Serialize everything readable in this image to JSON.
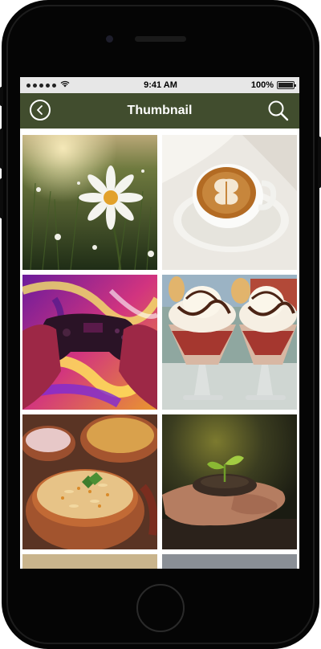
{
  "status_bar": {
    "time": "9:41 AM",
    "battery": "100%"
  },
  "app_bar": {
    "title": "Thumbnail"
  },
  "gallery": {
    "items": [
      {
        "subject": "daisy-field"
      },
      {
        "subject": "latte-art-coffee"
      },
      {
        "subject": "gaming-controller"
      },
      {
        "subject": "ice-cream-sundaes"
      },
      {
        "subject": "biryani-pot"
      },
      {
        "subject": "seedling-in-hands"
      }
    ]
  }
}
